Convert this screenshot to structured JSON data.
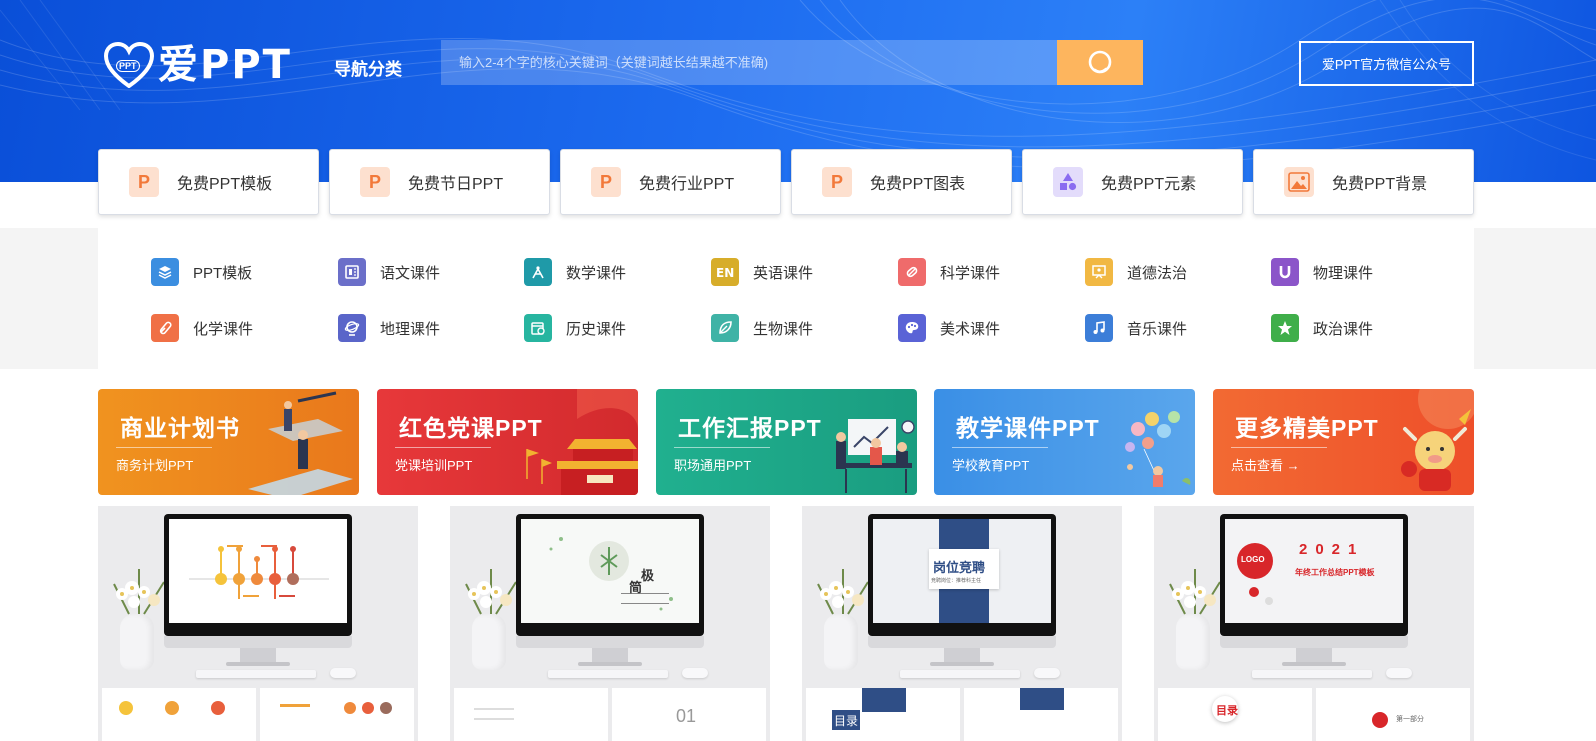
{
  "header": {
    "logo_text": "爱PPT",
    "logo_badge": "PPT",
    "nav_category": "导航分类",
    "search": {
      "placeholder": "输入2-4个字的核心关键词（关键词越长结果越不准确)"
    },
    "wechat_button": "爱PPT官方微信公众号"
  },
  "top_categories": [
    {
      "label": "免费PPT模板",
      "icon": "ppt-p-icon"
    },
    {
      "label": "免费节日PPT",
      "icon": "ppt-p-icon"
    },
    {
      "label": "免费行业PPT",
      "icon": "ppt-p-icon"
    },
    {
      "label": "免费PPT图表",
      "icon": "ppt-p-icon"
    },
    {
      "label": "免费PPT元素",
      "icon": "shapes-icon"
    },
    {
      "label": "免费PPT背景",
      "icon": "image-icon"
    }
  ],
  "subjects": [
    {
      "label": "PPT模板",
      "icon": "layers-icon",
      "color": "#3b8ee0"
    },
    {
      "label": "语文课件",
      "icon": "book-icon",
      "color": "#6b6fc9"
    },
    {
      "label": "数学课件",
      "icon": "compass-icon",
      "color": "#1f9aa8"
    },
    {
      "label": "英语课件",
      "icon": "en-icon",
      "color": "#d7ad2a"
    },
    {
      "label": "科学课件",
      "icon": "flask-icon",
      "color": "#ef6b6b"
    },
    {
      "label": "道德法治",
      "icon": "board-icon",
      "color": "#f1b843"
    },
    {
      "label": "物理课件",
      "icon": "magnet-icon",
      "color": "#8b55c9"
    },
    {
      "label": "化学课件",
      "icon": "tube-icon",
      "color": "#f07046"
    },
    {
      "label": "地理课件",
      "icon": "globe-icon",
      "color": "#5a65c9"
    },
    {
      "label": "历史课件",
      "icon": "calendar-icon",
      "color": "#27b5a0"
    },
    {
      "label": "生物课件",
      "icon": "leaf-icon",
      "color": "#3fb3a6"
    },
    {
      "label": "美术课件",
      "icon": "palette-icon",
      "color": "#5a63d6"
    },
    {
      "label": "音乐课件",
      "icon": "music-icon",
      "color": "#3c7ed8"
    },
    {
      "label": "政治课件",
      "icon": "star-icon",
      "color": "#3fae4a"
    }
  ],
  "banners": [
    {
      "title": "商业计划书",
      "subtitle": "商务计划PPT",
      "color_from": "#f0931f",
      "color_to": "#e9781c"
    },
    {
      "title": "红色党课PPT",
      "subtitle": "党课培训PPT",
      "color_from": "#e7383a",
      "color_to": "#d22a2d"
    },
    {
      "title": "工作汇报PPT",
      "subtitle": "职场通用PPT",
      "color_from": "#20b08f",
      "color_to": "#1a9d80"
    },
    {
      "title": "教学课件PPT",
      "subtitle": "学校教育PPT",
      "color_from": "#3a8fe6",
      "color_to": "#5aa6ec"
    },
    {
      "title": "更多精美PPT",
      "subtitle": "点击查看 →",
      "color_from": "#f26a33",
      "color_to": "#ee4f2a"
    }
  ],
  "previews": [
    {
      "screen_title": "",
      "screen_sub": "",
      "thumb_text": ""
    },
    {
      "screen_title": "极",
      "screen_sub": "简",
      "thumb_text": "01"
    },
    {
      "screen_title": "岗位竞聘",
      "screen_sub": "竞聘岗位：推荐科主任",
      "thumb_text": "目录"
    },
    {
      "screen_title": "2021",
      "screen_sub": "年终工作总结PPT模板",
      "thumb_text": "目录",
      "logo": "LOGO",
      "thumb_text2": "第一部分"
    }
  ]
}
